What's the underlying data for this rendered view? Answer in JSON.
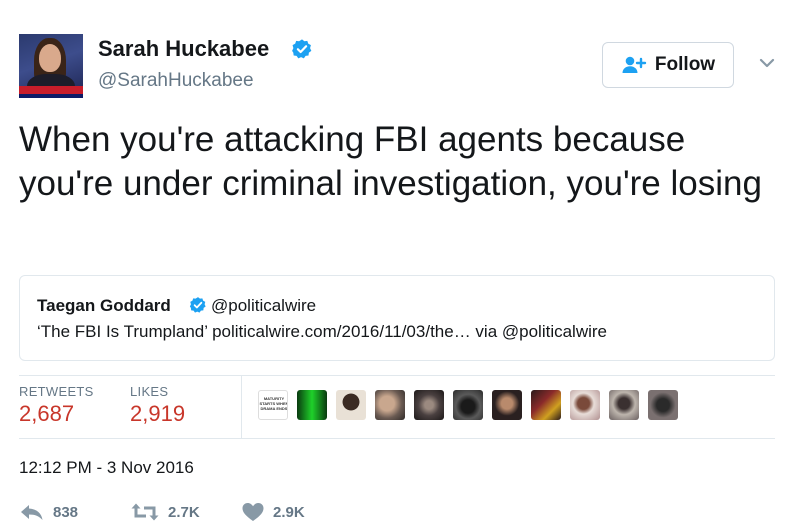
{
  "author": {
    "display_name": "Sarah Huckabee",
    "handle": "@SarahHuckabee",
    "verified": true
  },
  "follow_button": {
    "label": "Follow"
  },
  "tweet": {
    "text": "When you're attacking FBI agents because you're under criminal investigation, you're losing"
  },
  "quoted_tweet": {
    "display_name": "Taegan Goddard",
    "handle": "@politicalwire",
    "text": "‘The FBI Is Trumpland’ politicalwire.com/2016/11/03/the… via @politicalwire"
  },
  "stats": {
    "retweets_label": "RETWEETS",
    "retweets_value": "2,687",
    "likes_label": "LIKES",
    "likes_value": "2,919"
  },
  "likers": {
    "first_tile_text": "MATURITY STARTS WHEN DRAMA ENDS",
    "count_shown": 12
  },
  "timestamp": "12:12 PM - 3 Nov 2016",
  "actions": {
    "reply_count": "838",
    "retweet_count": "2.7K",
    "like_count": "2.9K"
  },
  "colors": {
    "text": "#14171a",
    "secondary": "#657786",
    "verified": "#1da1f2",
    "stat_value": "#c8362a",
    "border": "#e1e8ed"
  },
  "icons": [
    "verified-badge-icon",
    "add-user-icon",
    "chevron-down-icon",
    "reply-icon",
    "retweet-icon",
    "heart-icon"
  ]
}
